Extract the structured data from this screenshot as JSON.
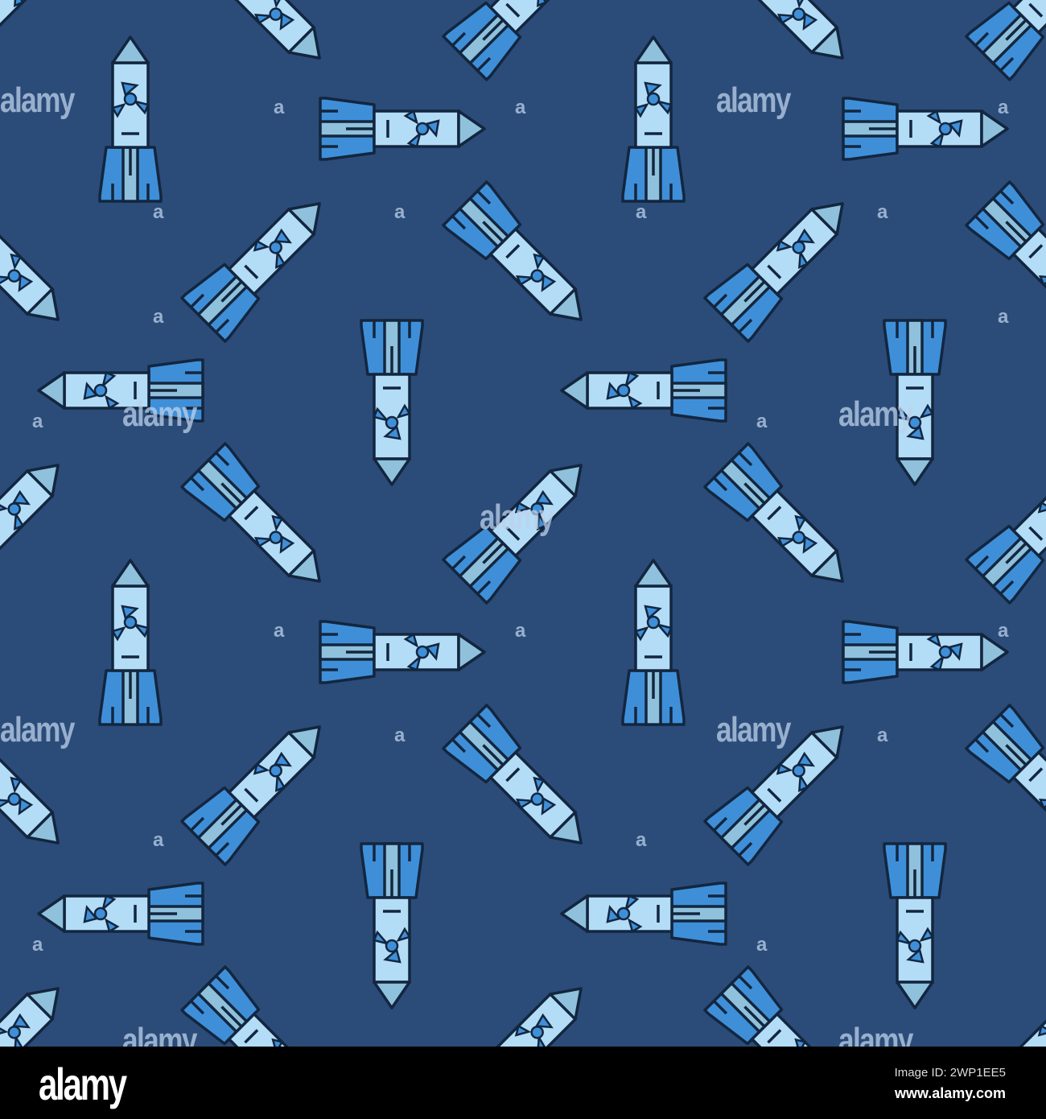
{
  "colors": {
    "background": "#2b4c79",
    "body": "#b3dcf7",
    "nose": "#8fc1dc",
    "fin": "#3f8fd8",
    "outline": "#13263f"
  },
  "watermark": {
    "text": "alamy",
    "letter": "a"
  },
  "footer": {
    "logo": "alamy",
    "image_id": "Image ID: 2WP1EE5",
    "url": "www.alamy.com"
  }
}
